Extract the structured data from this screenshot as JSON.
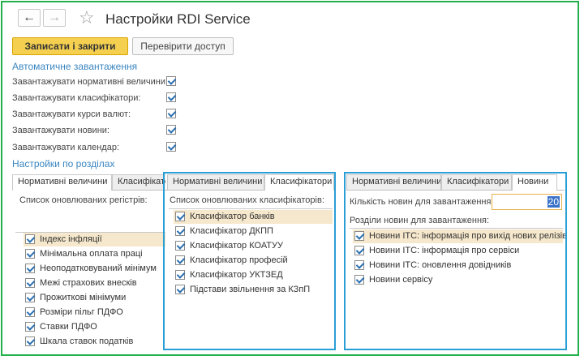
{
  "window": {
    "title": "Настройки RDI Service"
  },
  "toolbar": {
    "save_close": "Записати і закрити",
    "check_access": "Перевірити доступ"
  },
  "auto_load": {
    "heading": "Автоматичне завантаження",
    "rows": [
      {
        "label": "Завантажувати нормативні величини:",
        "checked": true
      },
      {
        "label": "Завантажувати класифікатори:",
        "checked": true
      },
      {
        "label": "Завантажувати курси валют:",
        "checked": true
      },
      {
        "label": "Завантажувати новини:",
        "checked": true
      },
      {
        "label": "Завантажувати календар:",
        "checked": true
      }
    ]
  },
  "sections": {
    "heading": "Настройки по розділах"
  },
  "pane1": {
    "tabs": [
      "Нормативні величини",
      "Класифікатори"
    ],
    "active_tab": 0,
    "list_label": "Список оновлюваних регістрів:",
    "items": [
      "Індекс інфляції",
      "Мінімальна оплата праці",
      "Неоподатковуваний мінімум",
      "Межі страхових внесків",
      "Прожиткові мінімуми",
      "Розміри пільг ПДФО",
      "Ставки ПДФО",
      "Шкала ставок податків"
    ]
  },
  "pane2": {
    "tabs": [
      "Нормативні величини",
      "Класифікатори"
    ],
    "active_tab": 1,
    "list_label": "Список оновлюваних класифікаторів:",
    "items": [
      "Класифікатор банків",
      "Класифікатор ДКПП",
      "Класифікатор КОАТУУ",
      "Класифікатор професій",
      "Класифікатор УКТЗЕД",
      "Підстави звільнення за КЗпП"
    ]
  },
  "pane3": {
    "tabs": [
      "Нормативні величини",
      "Класифікатори",
      "Новини"
    ],
    "active_tab": 2,
    "count_label": "Кількість новин для завантаження:",
    "count_value": "20",
    "list_label": "Розділи новин для завантаження:",
    "items": [
      "Новини ІТС: інформація про вихід нових релізів",
      "Новини ІТС: інформація про сервіси",
      "Новини ІТС: оновлення довідників",
      "Новини сервісу"
    ]
  },
  "colors": {
    "frame": "#22b04a",
    "highlight": "#2a9fd6",
    "primary_button": "#f5d050",
    "section_text": "#3b86c1"
  }
}
